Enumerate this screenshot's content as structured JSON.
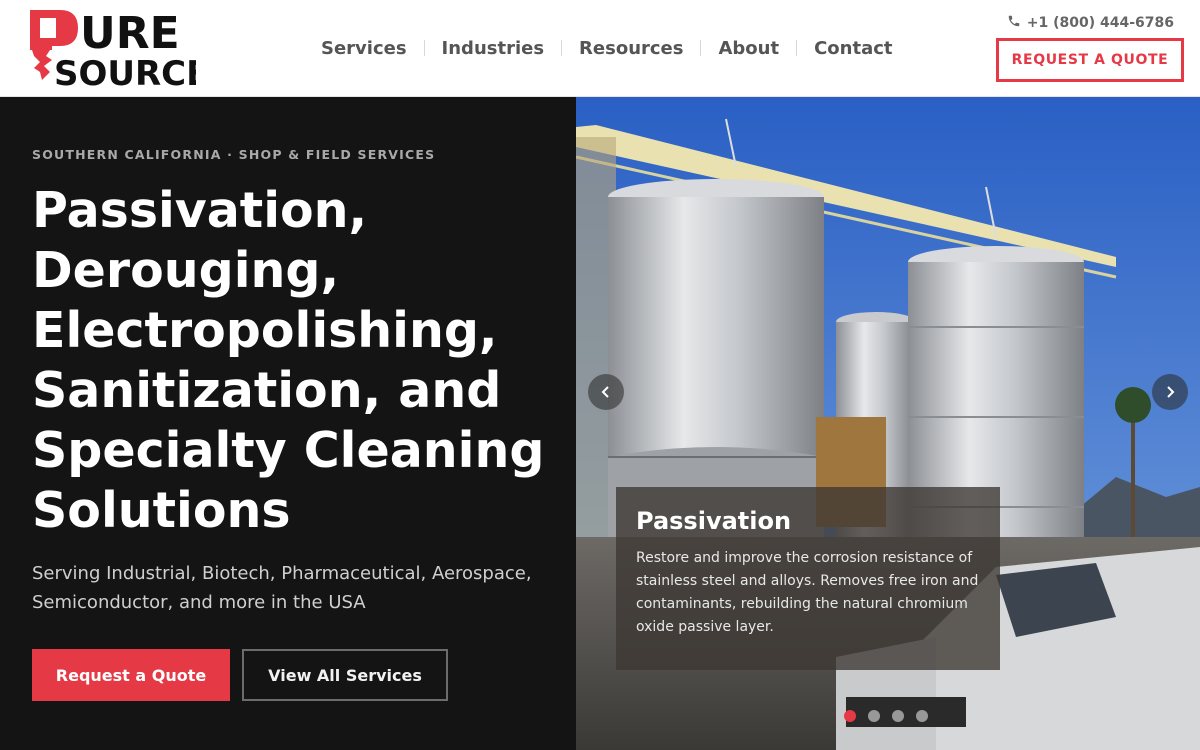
{
  "brand": {
    "logo_line1": "URE",
    "logo_line2": "SOURCE",
    "accent_color": "#e63946"
  },
  "nav": {
    "items": [
      "Services",
      "Industries",
      "Resources",
      "About",
      "Contact"
    ]
  },
  "header": {
    "phone": "+1 (800) 444-6786",
    "phone_icon": "phone-icon",
    "quote_label": "REQUEST A QUOTE"
  },
  "hero": {
    "eyebrow": "SOUTHERN CALIFORNIA · SHOP & FIELD SERVICES",
    "headline": "Passivation, Derouging, Electropolishing, Sanitization, and Specialty Cleaning Solutions",
    "subtext": "Serving Industrial, Biotech, Pharmaceutical, Aerospace, Semiconductor, and more in the USA",
    "primary_cta": "Request a Quote",
    "secondary_cta": "View All Services"
  },
  "slider": {
    "caption_title": "Passivation",
    "caption_text": "Restore and improve the corrosion resistance of stainless steel and alloys. Removes free iron and contaminants, rebuilding the natural chromium oxide passive layer.",
    "active_slide": 1,
    "slide_count": 4
  }
}
